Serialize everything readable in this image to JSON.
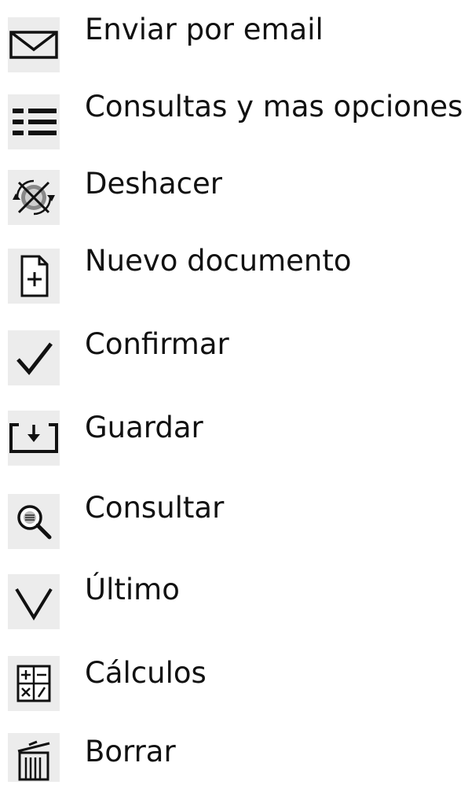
{
  "legend": {
    "items": [
      {
        "icon": "envelope-icon",
        "label": "Enviar por email"
      },
      {
        "icon": "list-icon",
        "label": "Consultas y mas opciones"
      },
      {
        "icon": "undo-icon",
        "label": "Deshacer"
      },
      {
        "icon": "new-document-icon",
        "label": "Nuevo documento"
      },
      {
        "icon": "checkmark-icon",
        "label": "Confirmar"
      },
      {
        "icon": "save-icon",
        "label": "Guardar"
      },
      {
        "icon": "magnifier-icon",
        "label": "Consultar"
      },
      {
        "icon": "chevron-down-icon",
        "label": "Último"
      },
      {
        "icon": "calculator-icon",
        "label": "Cálculos"
      },
      {
        "icon": "trash-icon",
        "label": "Borrar"
      }
    ]
  }
}
